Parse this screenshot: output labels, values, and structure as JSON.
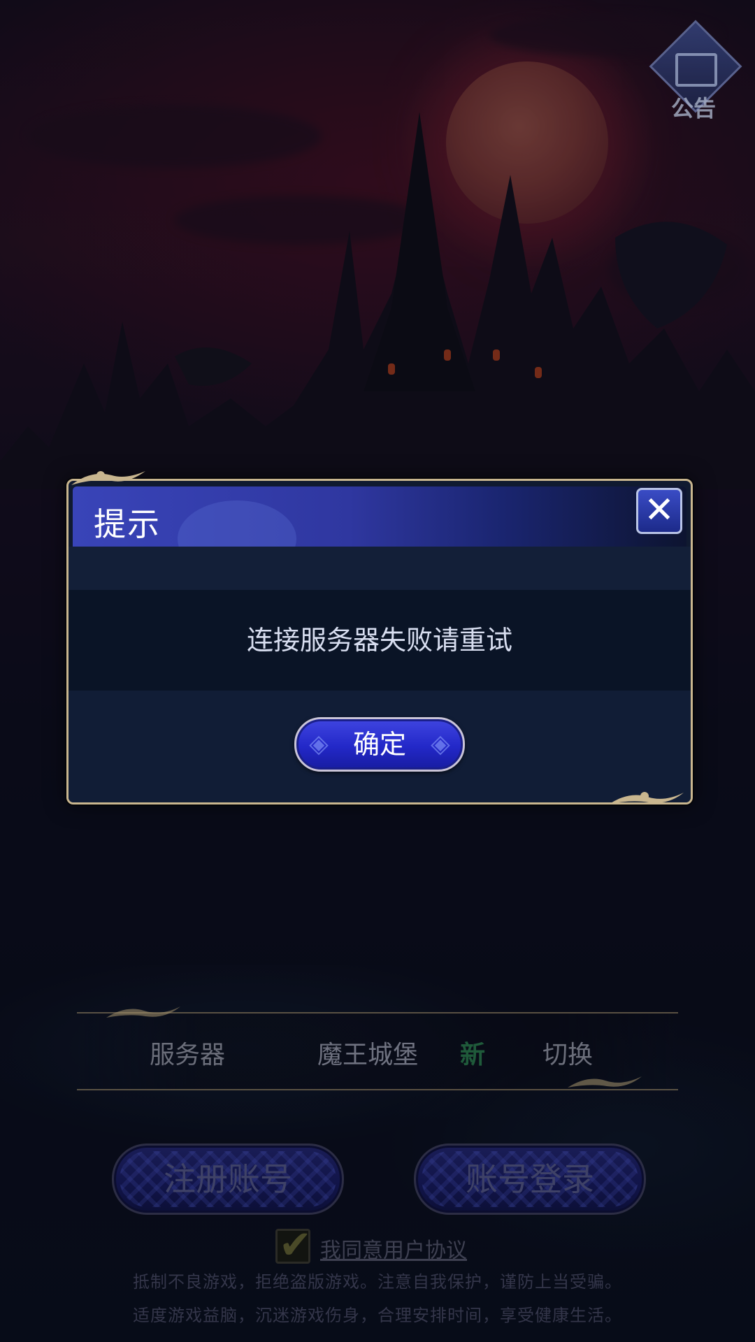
{
  "notice": {
    "label": "公告"
  },
  "dialog": {
    "title": "提示",
    "close_symbol": "✕",
    "message": "连接服务器失败请重试",
    "confirm_label": "确定"
  },
  "server": {
    "label": "服务器",
    "name": "魔王城堡",
    "badge": "新",
    "switch_label": "切换"
  },
  "buttons": {
    "register": "注册账号",
    "login": "账号登录"
  },
  "agreement": {
    "checked": true,
    "check_symbol": "✔",
    "text": "我同意用户协议"
  },
  "health_notice": {
    "line1": "抵制不良游戏，拒绝盗版游戏。注意自我保护，谨防上当受骗。",
    "line2": "适度游戏益脑，沉迷游戏伤身，合理安排时间，享受健康生活。"
  },
  "colors": {
    "dialog_border": "#c9b68f",
    "header_blue": "#3944b8",
    "button_blue": "#2328c8",
    "moon_red": "#a24a44"
  },
  "icons": [
    "announcement-board-icon",
    "close-icon",
    "checkmark-icon"
  ]
}
